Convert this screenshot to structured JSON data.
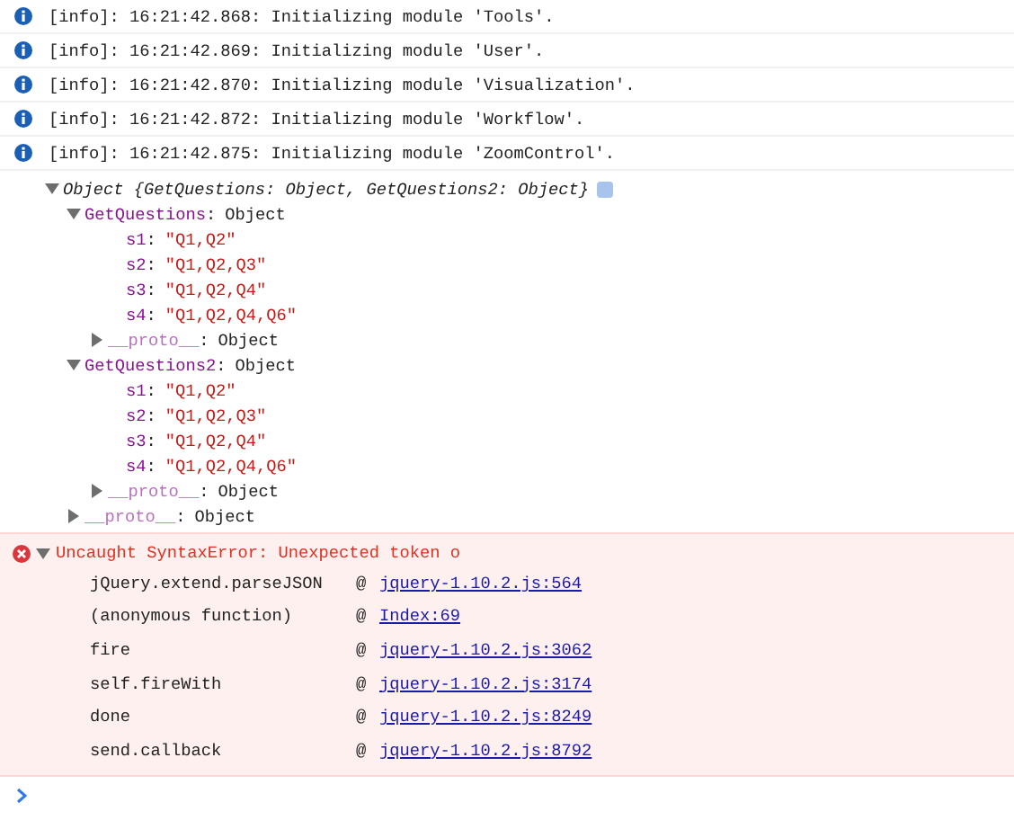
{
  "info_messages": [
    {
      "kind": "info",
      "text": "[info]: 16:21:42.868: Initializing module 'Tools'."
    },
    {
      "kind": "info",
      "text": "[info]: 16:21:42.869: Initializing module 'User'."
    },
    {
      "kind": "info",
      "text": "[info]: 16:21:42.870: Initializing module 'Visualization'."
    },
    {
      "kind": "info",
      "text": "[info]: 16:21:42.872: Initializing module 'Workflow'."
    },
    {
      "kind": "info",
      "text": "[info]: 16:21:42.875: Initializing module 'ZoomControl'."
    }
  ],
  "object_log": {
    "summary": "Object {GetQuestions: Object, GetQuestions2: Object}",
    "expanded": true,
    "children": [
      {
        "key": "GetQuestions",
        "separator": ":",
        "value": "Object",
        "kind": "object",
        "expanded": true,
        "children": [
          {
            "key": "s1",
            "separator": ":",
            "value": "\"Q1,Q2\"",
            "kind": "string"
          },
          {
            "key": "s2",
            "separator": ":",
            "value": "\"Q1,Q2,Q3\"",
            "kind": "string"
          },
          {
            "key": "s3",
            "separator": ":",
            "value": "\"Q1,Q2,Q4\"",
            "kind": "string"
          },
          {
            "key": "s4",
            "separator": ":",
            "value": "\"Q1,Q2,Q4,Q6\"",
            "kind": "string"
          },
          {
            "key": "__proto__",
            "separator": ":",
            "value": "Object",
            "kind": "proto",
            "expanded": false
          }
        ]
      },
      {
        "key": "GetQuestions2",
        "separator": ":",
        "value": "Object",
        "kind": "object",
        "expanded": true,
        "children": [
          {
            "key": "s1",
            "separator": ":",
            "value": "\"Q1,Q2\"",
            "kind": "string"
          },
          {
            "key": "s2",
            "separator": ":",
            "value": "\"Q1,Q2,Q3\"",
            "kind": "string"
          },
          {
            "key": "s3",
            "separator": ":",
            "value": "\"Q1,Q2,Q4\"",
            "kind": "string"
          },
          {
            "key": "s4",
            "separator": ":",
            "value": "\"Q1,Q2,Q4,Q6\"",
            "kind": "string"
          },
          {
            "key": "__proto__",
            "separator": ":",
            "value": "Object",
            "kind": "proto",
            "expanded": false
          }
        ]
      },
      {
        "key": "__proto__",
        "separator": ":",
        "value": "Object",
        "kind": "proto",
        "expanded": false
      }
    ]
  },
  "error": {
    "message": "Uncaught SyntaxError: Unexpected token o",
    "expanded": true,
    "stack": [
      {
        "function": "jQuery.extend.parseJSON",
        "separator": "@",
        "location": "jquery-1.10.2.js:564"
      },
      {
        "function": "(anonymous function)",
        "separator": "@",
        "location": "Index:69"
      },
      {
        "function": "fire",
        "separator": "@",
        "location": "jquery-1.10.2.js:3062"
      },
      {
        "function": "self.fireWith",
        "separator": "@",
        "location": "jquery-1.10.2.js:3174"
      },
      {
        "function": "done",
        "separator": "@",
        "location": "jquery-1.10.2.js:8249"
      },
      {
        "function": "send.callback",
        "separator": "@",
        "location": "jquery-1.10.2.js:8792"
      }
    ]
  }
}
